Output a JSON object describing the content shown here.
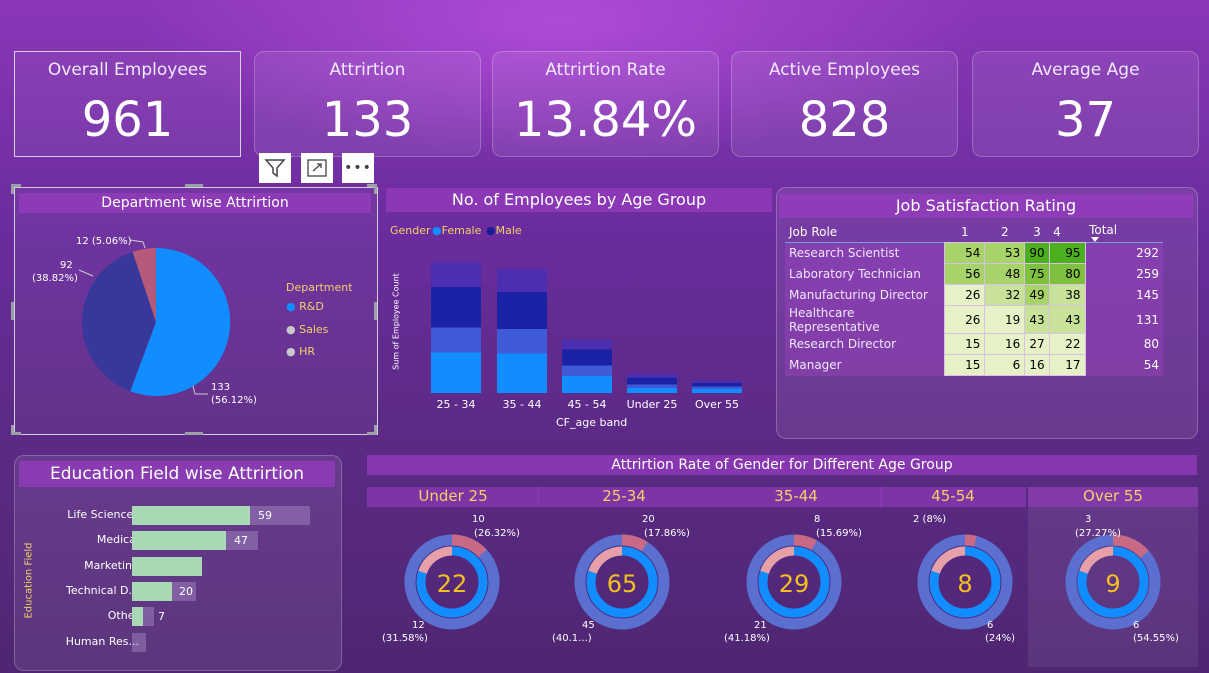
{
  "kpis": [
    {
      "title": "Overall Employees",
      "value": "961"
    },
    {
      "title": "Attrirtion",
      "value": "133"
    },
    {
      "title": "Attrirtion Rate",
      "value": "13.84%"
    },
    {
      "title": "Active Employees",
      "value": "828"
    },
    {
      "title": "Average Age",
      "value": "37"
    }
  ],
  "toolbar": {
    "filter_icon": "filter-icon",
    "focus_icon": "focus-mode-icon",
    "more_label": "•••"
  },
  "dept": {
    "title": "Department wise Attrirtion",
    "legend_title": "Department",
    "legend": [
      {
        "label": "R&D",
        "color": "#118dff"
      },
      {
        "label": "Sales",
        "color": "#c9c9c9"
      },
      {
        "label": "HR",
        "color": "#c9c9c9"
      }
    ],
    "labels": {
      "rd_count": "133",
      "rd_pct": "(56.12%)",
      "sales_count": "92",
      "sales_pct": "(38.82%)",
      "hr": "12 (5.06%)"
    }
  },
  "age": {
    "title": "No. of Employees by Age Group",
    "legend_title": "Gender",
    "female": "Female",
    "male": "Male",
    "ylabel": "Sum of Employee Count",
    "xlabel": "CF_age band"
  },
  "jobsat": {
    "title": "Job Satisfaction Rating",
    "headers": [
      "Job Role",
      "1",
      "2",
      "3",
      "4",
      "Total"
    ],
    "rows": [
      {
        "role": "Research Scientist",
        "v": [
          "54",
          "53",
          "90",
          "95"
        ],
        "total": "292"
      },
      {
        "role": "Laboratory Technician",
        "v": [
          "56",
          "48",
          "75",
          "80"
        ],
        "total": "259"
      },
      {
        "role": "Manufacturing Director",
        "v": [
          "26",
          "32",
          "49",
          "38"
        ],
        "total": "145"
      },
      {
        "role": "Healthcare Representative",
        "v": [
          "26",
          "19",
          "43",
          "43"
        ],
        "total": "131"
      },
      {
        "role": "Research Director",
        "v": [
          "15",
          "16",
          "27",
          "22"
        ],
        "total": "80"
      },
      {
        "role": "Manager",
        "v": [
          "15",
          "6",
          "16",
          "17"
        ],
        "total": "54"
      }
    ]
  },
  "edu": {
    "title": "Education Field wise Attrirtion",
    "ylabel": "Education Field",
    "rows": [
      {
        "label": "Life Sciences",
        "value": "59"
      },
      {
        "label": "Medical",
        "value": "47"
      },
      {
        "label": "Marketing",
        "value": ""
      },
      {
        "label": "Technical D...",
        "value": "20"
      },
      {
        "label": "Other",
        "value": "7"
      },
      {
        "label": "Human Res...",
        "value": ""
      }
    ]
  },
  "gender": {
    "title": "Attrirtion Rate of Gender for Different Age Group",
    "groups": [
      {
        "title": "Under 25",
        "center": "22",
        "top": "10",
        "top_pct": "(26.32%)",
        "bot": "12",
        "bot_pct": "(31.58%)"
      },
      {
        "title": "25-34",
        "center": "65",
        "top": "20",
        "top_pct": "(17.86%)",
        "bot": "45",
        "bot_pct": "(40.1...)"
      },
      {
        "title": "35-44",
        "center": "29",
        "top": "8",
        "top_pct": "(15.69%)",
        "bot": "21",
        "bot_pct": "(41.18%)"
      },
      {
        "title": "45-54",
        "center": "8",
        "top": "2 (8%)",
        "top_pct": "",
        "bot": "6",
        "bot_pct": "(24%)"
      },
      {
        "title": "Over 55",
        "center": "9",
        "top": "3",
        "top_pct": "(27.27%)",
        "bot": "6",
        "bot_pct": "(54.55%)"
      }
    ]
  },
  "chart_data": [
    {
      "type": "pie",
      "title": "Department wise Attrirtion",
      "categories": [
        "R&D",
        "Sales",
        "HR"
      ],
      "values": [
        133,
        92,
        12
      ],
      "colors": [
        "#118dff",
        "#3a3a9a",
        "#b05a7a"
      ]
    },
    {
      "type": "bar",
      "title": "No. of Employees by Age Group",
      "categories": [
        "25 - 34",
        "35 - 44",
        "45 - 54",
        "Under 25",
        "Over 55"
      ],
      "series": [
        {
          "name": "Female",
          "values": [
            131,
            128,
            55,
            17,
            13
          ]
        },
        {
          "name": "Male",
          "values": [
            131,
            120,
            52,
            22,
            12
          ]
        }
      ],
      "xlabel": "CF_age band",
      "ylabel": "Sum of Employee Count"
    },
    {
      "type": "bar",
      "title": "Education Field wise Attrirtion",
      "categories": [
        "Life Sciences",
        "Medical",
        "Marketing",
        "Technical D...",
        "Other",
        "Human Res..."
      ],
      "values": [
        59,
        47,
        35,
        20,
        7,
        7
      ]
    }
  ]
}
